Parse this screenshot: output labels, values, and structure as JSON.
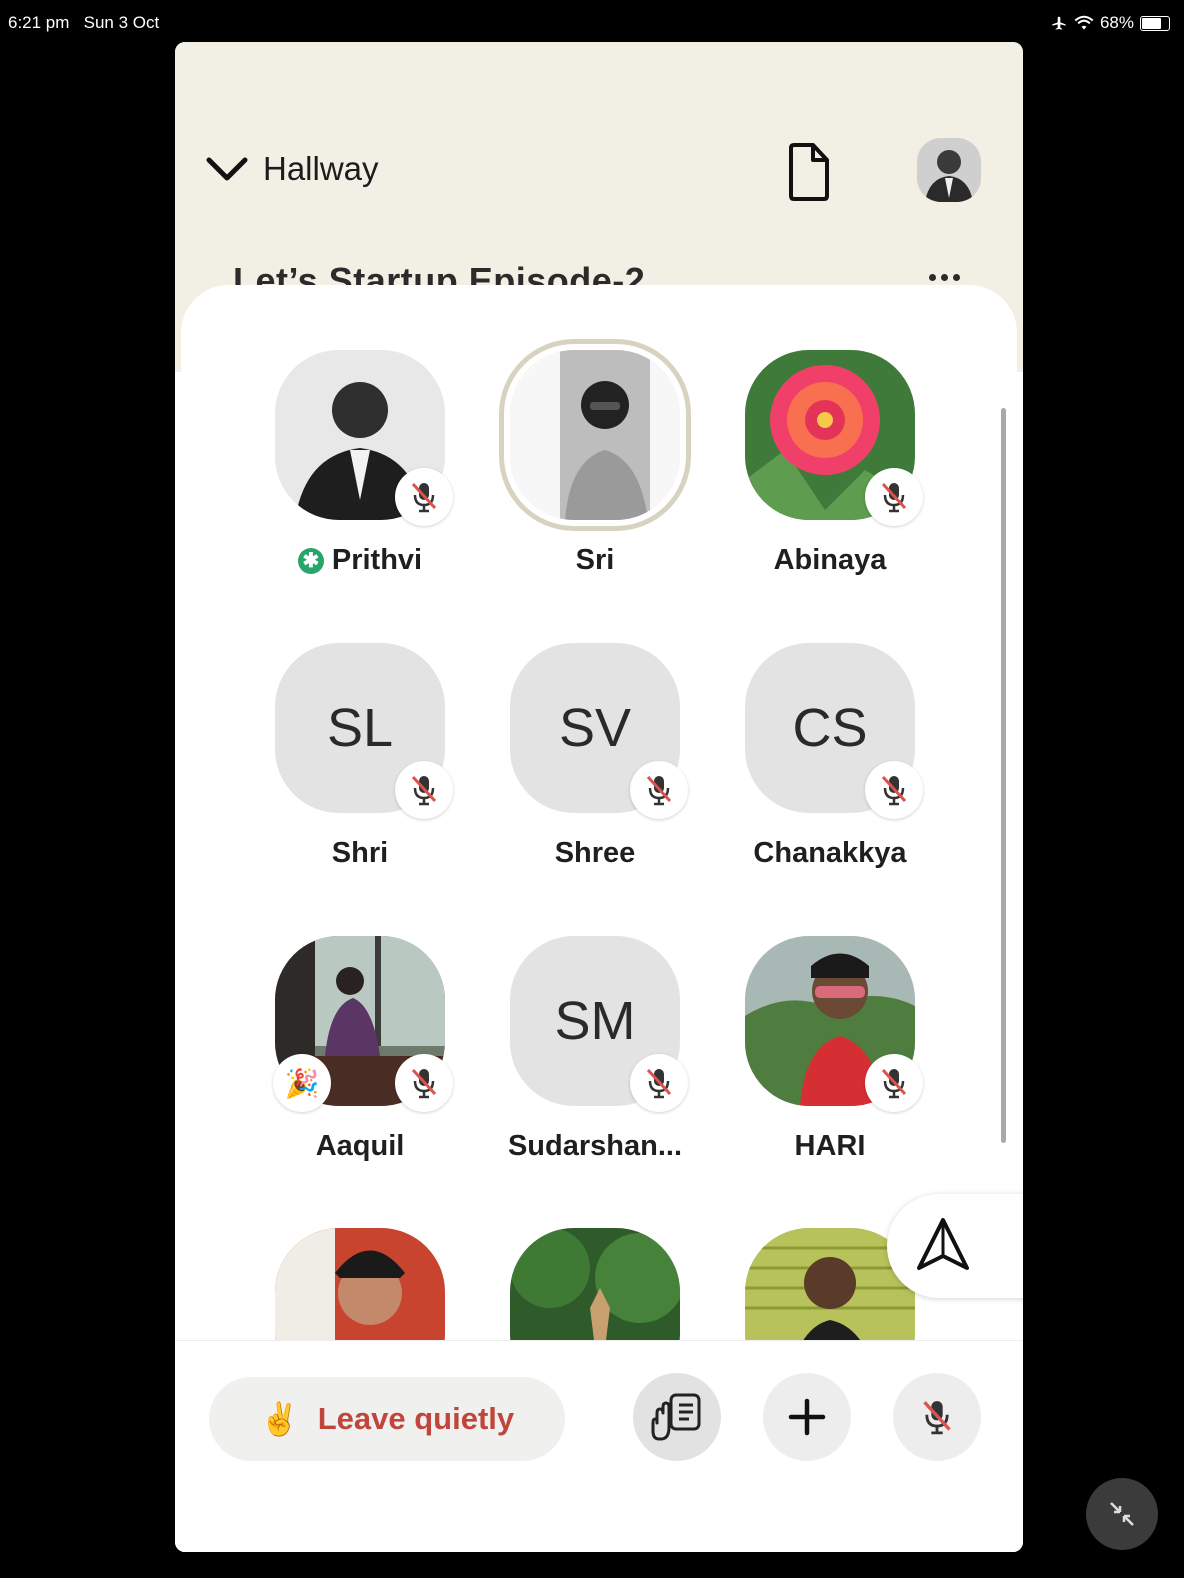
{
  "status_bar": {
    "time": "6:21 pm",
    "date": "Sun 3 Oct",
    "battery": "68%",
    "battery_level": 0.68,
    "airplane_icon": "airplane-icon",
    "wifi_icon": "wifi-icon"
  },
  "header": {
    "back_label": "Hallway",
    "back_icon": "chevron-down-icon",
    "document_icon": "document-icon",
    "profile_icon": "avatar"
  },
  "room": {
    "title": "Let’s Startup,Episode-2",
    "more_icon": "more-icon"
  },
  "speakers": [
    {
      "name": "Prithvi",
      "initials": "",
      "photo": "photo-man-suit-bw",
      "muted": true,
      "moderator": true
    },
    {
      "name": "Sri",
      "initials": "",
      "photo": "photo-man-glasses-bw",
      "muted": false,
      "speaking": true
    },
    {
      "name": "Abinaya",
      "initials": "",
      "photo": "photo-pink-flower",
      "muted": true
    },
    {
      "name": "Shri",
      "initials": "SL",
      "muted": true
    },
    {
      "name": "Shree",
      "initials": "SV",
      "muted": true
    },
    {
      "name": "Chanakkya",
      "initials": "CS",
      "muted": true
    },
    {
      "name": "Aaquil",
      "initials": "",
      "photo": "photo-window-sitting",
      "muted": true,
      "new_user": true
    },
    {
      "name": "Sudarshan...",
      "initials": "SM",
      "muted": true
    },
    {
      "name": "HARI",
      "initials": "",
      "photo": "photo-man-red-shirt",
      "muted": true
    },
    {
      "name": "",
      "initials": "",
      "photo": "photo-man-curly-hair"
    },
    {
      "name": "",
      "initials": "",
      "photo": "photo-deer-forest"
    },
    {
      "name": "",
      "initials": "",
      "photo": "photo-man-yellow-wall"
    }
  ],
  "bottom_bar": {
    "leave_label": "Leave quietly",
    "leave_emoji": "✌️",
    "raise_hand_icon": "raise-hand-icon",
    "add_icon": "plus-icon",
    "mic_icon": "mic-muted-icon"
  },
  "colors": {
    "header_bg": "#f2efe4",
    "leave_text": "#c0463c",
    "moderator_badge": "#28a56a",
    "mute_slash": "#d9534f"
  }
}
